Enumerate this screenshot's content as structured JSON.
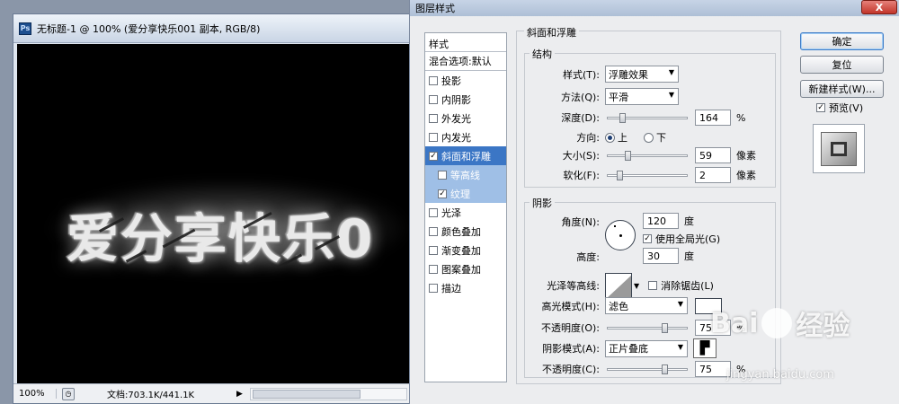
{
  "document": {
    "title": "无标题-1 @ 100% (爱分享快乐001 副本, RGB/8)",
    "app_icon": "Ps",
    "canvas_text": "爱分享快乐0",
    "status": {
      "zoom": "100%",
      "doc_info": "文档:703.1K/441.1K"
    }
  },
  "dialog": {
    "title": "图层样式",
    "close_label": "X",
    "style_list": {
      "header": "样式",
      "blend_options": "混合选项:默认",
      "items": [
        {
          "label": "投影",
          "checked": false
        },
        {
          "label": "内阴影",
          "checked": false
        },
        {
          "label": "外发光",
          "checked": false
        },
        {
          "label": "内发光",
          "checked": false
        },
        {
          "label": "斜面和浮雕",
          "checked": true,
          "selected": true
        },
        {
          "label": "等高线",
          "checked": false,
          "sub": true
        },
        {
          "label": "纹理",
          "checked": true,
          "sub": true
        },
        {
          "label": "光泽",
          "checked": false
        },
        {
          "label": "颜色叠加",
          "checked": false
        },
        {
          "label": "渐变叠加",
          "checked": false
        },
        {
          "label": "图案叠加",
          "checked": false
        },
        {
          "label": "描边",
          "checked": false
        }
      ]
    },
    "bevel": {
      "section_title": "斜面和浮雕",
      "structure_title": "结构",
      "style_label": "样式(T):",
      "style_value": "浮雕效果",
      "method_label": "方法(Q):",
      "method_value": "平滑",
      "depth_label": "深度(D):",
      "depth_value": "164",
      "depth_unit": "%",
      "depth_level": 0.16,
      "direction_label": "方向:",
      "direction_up": "上",
      "direction_down": "下",
      "size_label": "大小(S):",
      "size_value": "59",
      "size_unit": "像素",
      "size_level": 0.24,
      "soften_label": "软化(F):",
      "soften_value": "2",
      "soften_unit": "像素",
      "soften_level": 0.12
    },
    "shading": {
      "title": "阴影",
      "angle_label": "角度(N):",
      "angle_value": "120",
      "angle_unit": "度",
      "global_light_label": "使用全局光(G)",
      "altitude_label": "高度:",
      "altitude_value": "30",
      "altitude_unit": "度",
      "gloss_label": "光泽等高线:",
      "antialias_label": "消除锯齿(L)",
      "highlight_mode_label": "高光模式(H):",
      "highlight_mode_value": "滤色",
      "highlight_color": "#ffffff",
      "highlight_opacity_label": "不透明度(O):",
      "highlight_opacity_value": "75",
      "highlight_opacity_level": 0.75,
      "shadow_mode_label": "阴影模式(A):",
      "shadow_mode_value": "正片叠底",
      "shadow_opacity_label": "不透明度(C):",
      "shadow_opacity_value": "75",
      "shadow_opacity_level": 0.75,
      "percent": "%"
    },
    "buttons": {
      "ok": "确定",
      "reset": "复位",
      "new_style": "新建样式(W)...",
      "preview": "预览(V)"
    }
  },
  "watermark": {
    "brand": "Bai",
    "brand_suffix": "经验",
    "url": "jingyan.baidu.com"
  }
}
